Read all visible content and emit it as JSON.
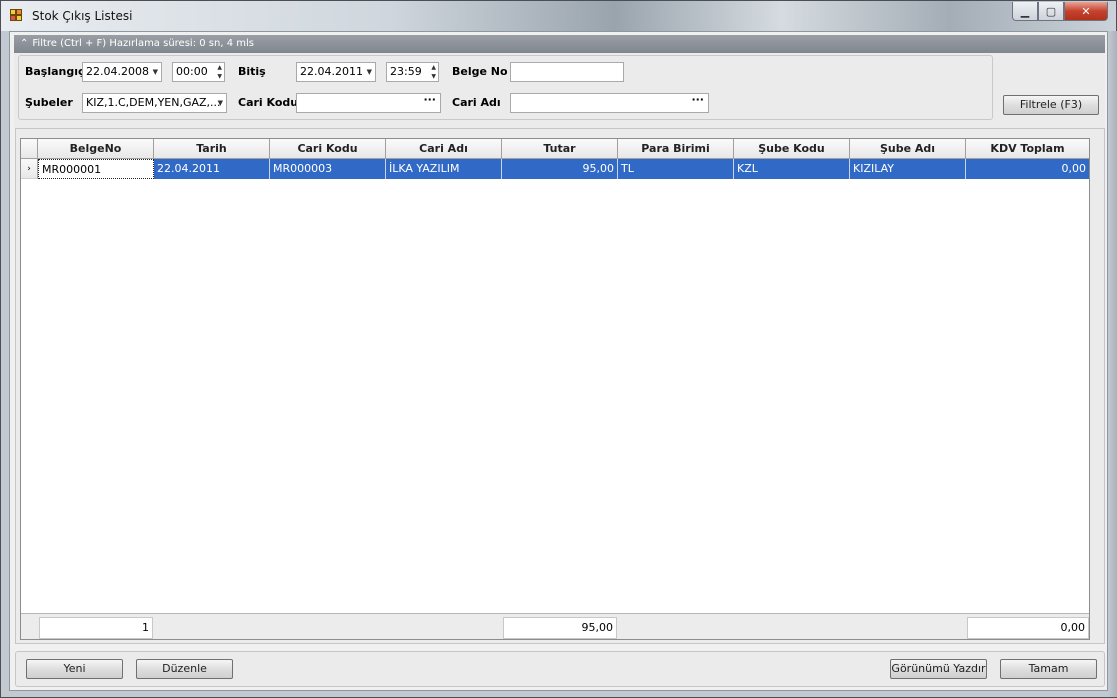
{
  "window": {
    "title": "Stok Çıkış Listesi",
    "min_glyph": "▁",
    "max_glyph": "▢",
    "close_glyph": "✕"
  },
  "filter": {
    "header_text": "Filtre (Ctrl + F) Hazırlama süresi: 0 sn, 4 mls",
    "collapse_glyph": "⌃",
    "start_label": "Başlangıç",
    "start_date": "22.04.2008",
    "start_time": "00:00",
    "end_label": "Bitiş",
    "end_date": "22.04.2011",
    "end_time": "23:59",
    "doc_no_label": "Belge No",
    "doc_no_value": "",
    "branches_label": "Şubeler",
    "branches_value": "KIZ,1.C,DEM,YEN,GAZ,...",
    "account_code_label": "Cari Kodu",
    "account_code_value": "",
    "account_name_label": "Cari Adı",
    "account_name_value": "",
    "filter_button": "Filtrele (F3)",
    "lookup_glyph": "···",
    "dropdown_glyph": "▼",
    "spin_up_glyph": "▲",
    "spin_down_glyph": "▼"
  },
  "grid": {
    "columns": [
      "BelgeNo",
      "Tarih",
      "Cari Kodu",
      "Cari Adı",
      "Tutar",
      "Para Birimi",
      "Şube Kodu",
      "Şube Adı",
      "KDV Toplam"
    ],
    "rows": [
      {
        "indicator": "›",
        "cells": [
          "MR000001",
          "22.04.2011",
          "MR000003",
          "İLKA YAZILIM",
          "95,00",
          "TL",
          "KZL",
          "KIZILAY",
          "0,00"
        ]
      }
    ],
    "footer": {
      "count": "1",
      "tutar_sum": "95,00",
      "kdv_sum": "0,00"
    }
  },
  "actions": {
    "new": "Yeni",
    "edit": "Düzenle",
    "print_view": "Görünümü Yazdır",
    "ok": "Tamam"
  },
  "colors": {
    "selection": "#3169c6",
    "header_bar": "#8a9098"
  }
}
